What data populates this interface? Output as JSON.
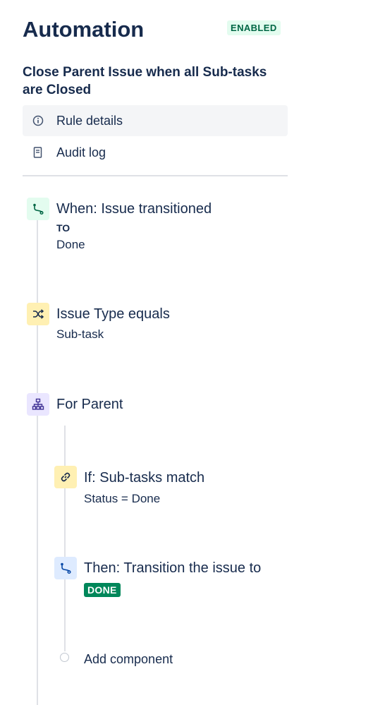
{
  "header": {
    "title": "Automation",
    "status_badge": "ENABLED"
  },
  "rule": {
    "name": "Close Parent Issue when all Sub-tasks are Closed"
  },
  "nav": {
    "items": [
      {
        "label": "Rule details",
        "icon": "info-icon",
        "selected": true
      },
      {
        "label": "Audit log",
        "icon": "document-icon",
        "selected": false
      }
    ]
  },
  "steps": {
    "trigger": {
      "title": "When: Issue transitioned",
      "keyword": "TO",
      "value": "Done",
      "icon": "transition-icon",
      "color": "#e3fcef"
    },
    "condition": {
      "title": "Issue Type equals",
      "value": "Sub-task",
      "icon": "shuffle-icon",
      "color": "#fff0b3"
    },
    "branch": {
      "title": "For Parent",
      "icon": "hierarchy-icon",
      "color": "#eae6ff"
    },
    "branch_condition": {
      "title": "If: Sub-tasks match",
      "value": "Status = Done",
      "icon": "link-icon",
      "color": "#fff0b3"
    },
    "action": {
      "title": "Then: Transition the issue to",
      "status": "DONE",
      "icon": "transition-icon",
      "color": "#deebff"
    },
    "add_component": {
      "label": "Add component"
    }
  }
}
